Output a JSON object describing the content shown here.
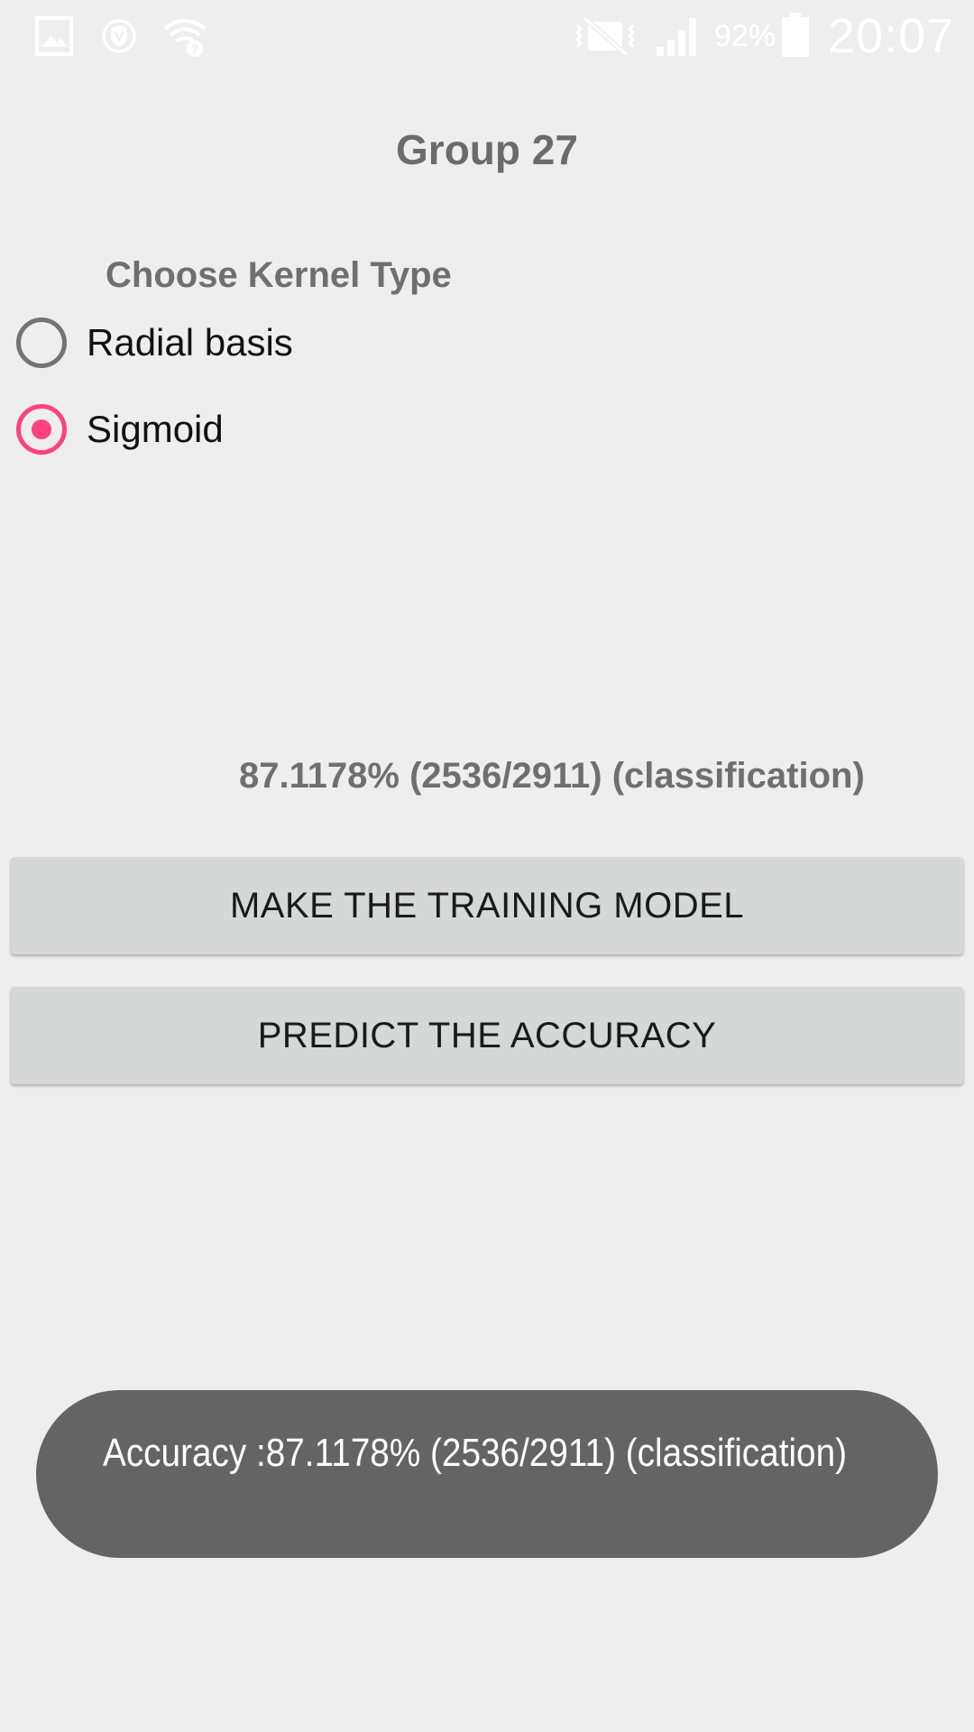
{
  "status_bar": {
    "icons": [
      "gallery-icon",
      "shield-icon",
      "wifi-icon",
      "vibrate-mute-icon",
      "signal-icon",
      "battery-icon"
    ],
    "battery_percent": "92%",
    "time": "20:07"
  },
  "app": {
    "title": "Group 27",
    "kernel_heading": "Choose Kernel Type",
    "kernel_options": [
      {
        "label": "Radial basis",
        "selected": false
      },
      {
        "label": "Sigmoid",
        "selected": true
      }
    ],
    "result": "87.1178% (2536/2911) (classification)",
    "buttons": {
      "train": "MAKE THE TRAINING MODEL",
      "predict": "PREDICT THE ACCURACY"
    }
  },
  "toast": {
    "message": "Accuracy :87.1178% (2536/2911) (classification)"
  },
  "colors": {
    "accent": "#ff4081",
    "background": "#eeeeee",
    "button": "#d6d7d7",
    "toast": "#646464"
  }
}
